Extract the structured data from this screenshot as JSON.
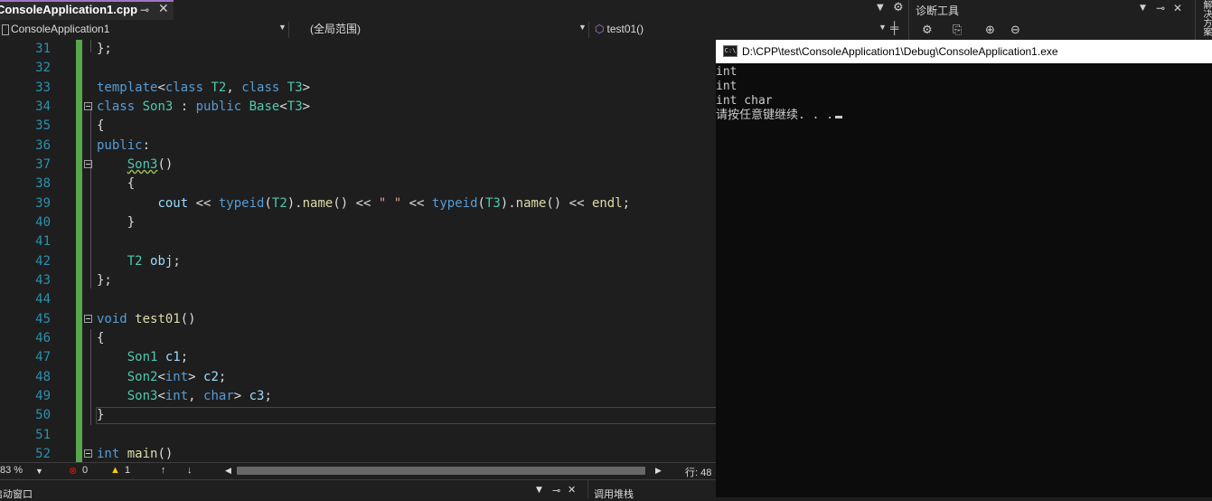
{
  "tab": {
    "title": "ConsoleApplication1.cpp",
    "pin": "⊸",
    "close": "✕"
  },
  "navbar": {
    "project": "ConsoleApplication1",
    "scope": "(全局范围)",
    "member": "test01()"
  },
  "editor": {
    "lines": [
      {
        "n": "31"
      },
      {
        "n": "32"
      },
      {
        "n": "33"
      },
      {
        "n": "34"
      },
      {
        "n": "35"
      },
      {
        "n": "36"
      },
      {
        "n": "37"
      },
      {
        "n": "38"
      },
      {
        "n": "39"
      },
      {
        "n": "40"
      },
      {
        "n": "41"
      },
      {
        "n": "42"
      },
      {
        "n": "43"
      },
      {
        "n": "44"
      },
      {
        "n": "45"
      },
      {
        "n": "46"
      },
      {
        "n": "47"
      },
      {
        "n": "48"
      },
      {
        "n": "49"
      },
      {
        "n": "50"
      },
      {
        "n": "51"
      },
      {
        "n": "52"
      }
    ]
  },
  "status": {
    "zoom": "83 %",
    "errors": "0",
    "warnings": "1",
    "line": "行: 48"
  },
  "bottom": {
    "left_label": "启动窗口",
    "right_label": "调用堆栈"
  },
  "console": {
    "title": "D:\\CPP\\test\\ConsoleApplication1\\Debug\\ConsoleApplication1.exe",
    "icon": "C:\\",
    "output": [
      "int",
      "int",
      "int char",
      "请按任意键继续. . ."
    ]
  },
  "diagnostics": {
    "title": "诊断工具"
  },
  "side_tab": {
    "label": "解决方案"
  }
}
